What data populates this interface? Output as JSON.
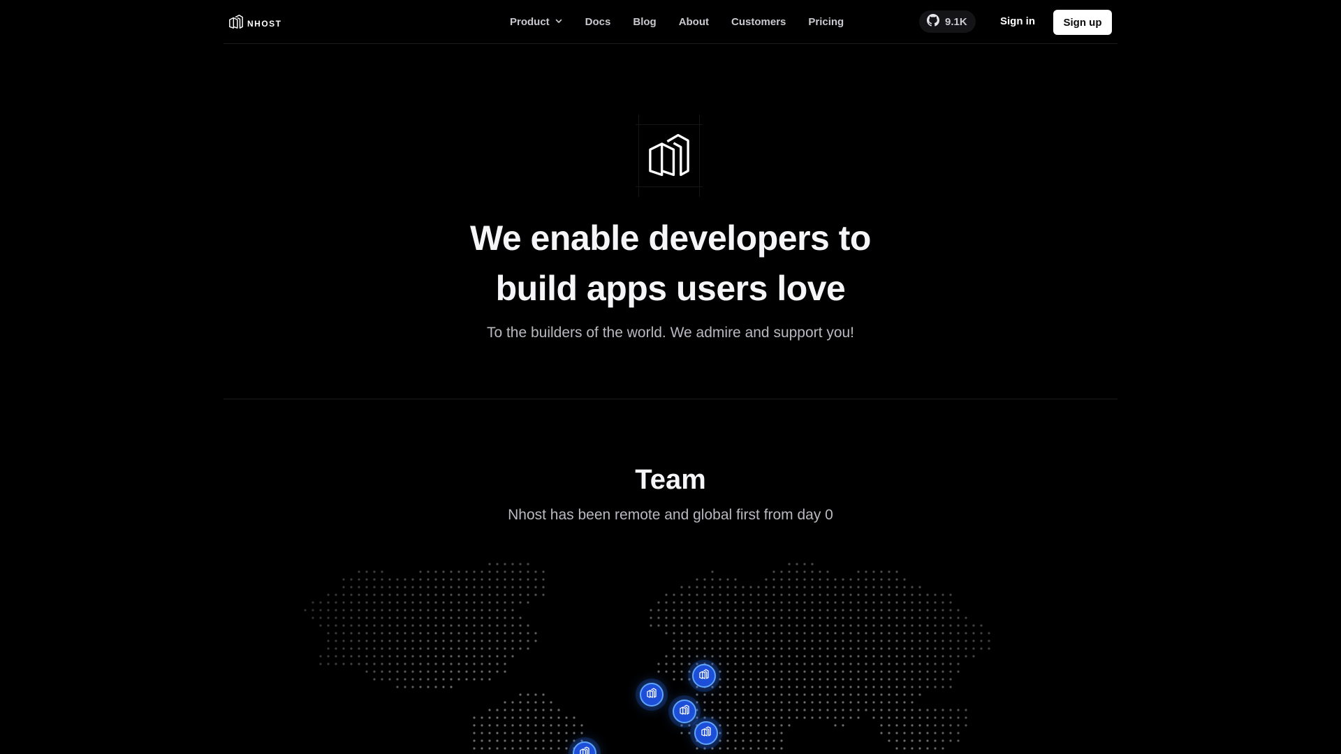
{
  "nav": {
    "brand": "NHOST",
    "menu": [
      {
        "label": "Product",
        "has_dropdown": true
      },
      {
        "label": "Docs"
      },
      {
        "label": "Blog"
      },
      {
        "label": "About"
      },
      {
        "label": "Customers"
      },
      {
        "label": "Pricing"
      }
    ],
    "github_count": "9.1K",
    "signin": "Sign in",
    "signup": "Sign up"
  },
  "hero": {
    "title_line1": "We enable developers to",
    "title_line2": "build apps users love",
    "subtitle": "To the builders of the world. We admire and support you!"
  },
  "team": {
    "title": "Team",
    "subtitle": "Nhost has been remote and global first from day 0"
  },
  "map": {
    "marker_icon": "nhost-logo-icon",
    "marker_color": "#1d4ed8",
    "marker_count": 5
  }
}
